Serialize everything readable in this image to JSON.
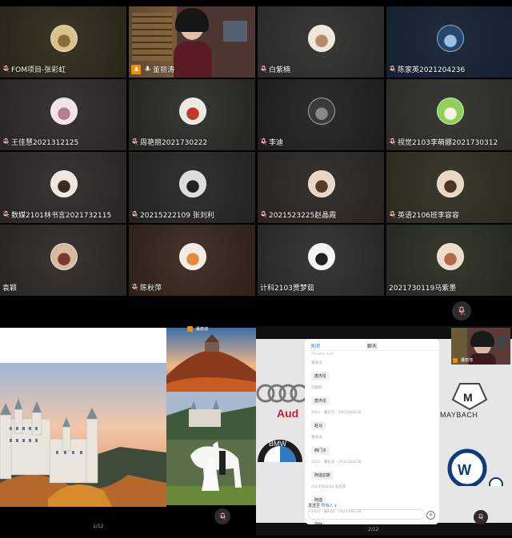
{
  "participants": [
    {
      "name": "FOM项目-张彩虹",
      "bg": [
        "#3d3626",
        "#2a2418"
      ],
      "av": [
        "#d9c28a",
        "#8a6b3a"
      ],
      "mic": true
    },
    {
      "name": "董丽涛",
      "bg": [
        "#3a2f2a",
        "#5a3b36"
      ],
      "av": null,
      "mic": true,
      "speaking": true,
      "video": true
    },
    {
      "name": "白紫楠",
      "bg": [
        "#3b3a37",
        "#28292a"
      ],
      "av": [
        "#f0e6da",
        "#b58b6a"
      ],
      "mic": true
    },
    {
      "name": "陈家英2021204236",
      "bg": [
        "#1f2c3d",
        "#152130"
      ],
      "av": [
        "#25466d",
        "#9ac0e8"
      ],
      "mic": true
    },
    {
      "name": "王佳慧2021312125",
      "bg": [
        "#3c3438",
        "#2a2527"
      ],
      "av": [
        "#f2e5ea",
        "#b87f8c"
      ],
      "mic": true
    },
    {
      "name": "周艳丽2021730222",
      "bg": [
        "#3a3a36",
        "#24251f"
      ],
      "av": [
        "#ece9e0",
        "#c23a2c"
      ],
      "mic": true
    },
    {
      "name": "李迪",
      "bg": [
        "#2e2e2e",
        "#1d1d1d"
      ],
      "av": [
        "#3a3a3a",
        "#888888"
      ],
      "mic": true
    },
    {
      "name": "视觉2103李萌娜2021730312",
      "bg": [
        "#3b3b35",
        "#2b2c26"
      ],
      "av": [
        "#8fd15a",
        "#f4f1e2"
      ],
      "mic": true
    },
    {
      "name": "数媒2101林书言2021732115",
      "bg": [
        "#3a3633",
        "#282523"
      ],
      "av": [
        "#efe6de",
        "#3c2c24"
      ],
      "mic": true
    },
    {
      "name": "20215222109 张刘利",
      "bg": [
        "#333333",
        "#222222"
      ],
      "av": [
        "#dcdcdc",
        "#222222"
      ],
      "mic": true
    },
    {
      "name": "2021523225赵晶霞",
      "bg": [
        "#393430",
        "#27231f"
      ],
      "av": [
        "#e8d6c8",
        "#5b3a2a"
      ],
      "mic": true
    },
    {
      "name": "英语2106班李容容",
      "bg": [
        "#3d3a2e",
        "#2b2a20"
      ],
      "av": [
        "#e8d8c2",
        "#4a3422"
      ],
      "mic": true
    },
    {
      "name": "袁颖",
      "bg": [
        "#3a3632",
        "#282420"
      ],
      "av": [
        "#d7b8a0",
        "#7b3b2a"
      ],
      "mic": false
    },
    {
      "name": "陈秋萍",
      "bg": [
        "#473428",
        "#2c2018"
      ],
      "av": [
        "#f3ece4",
        "#e58a3c"
      ],
      "mic": true
    },
    {
      "name": "计科2103贾梦茹",
      "bg": [
        "#3a3a3a",
        "#262626"
      ],
      "av": [
        "#f5f5f5",
        "#222222"
      ],
      "mic": false
    },
    {
      "name": "2021730119马紫墨",
      "bg": [
        "#373a2e",
        "#25281f"
      ],
      "av": [
        "#ecdcc8",
        "#b06a4a"
      ],
      "mic": false
    }
  ],
  "left_pane": {
    "page_indicator": "1/12",
    "thumb_label": "董丽涛"
  },
  "right_pane": {
    "page_indicator": "2/12",
    "thumb_label": "董丽涛",
    "logos": {
      "audi": "Audi",
      "maybach": "MAYBACH",
      "vw_caption": "Volkswagen"
    }
  },
  "chat": {
    "back_label": "关闭",
    "title": "聊天",
    "top_clip": "Theodric Audi",
    "messages": [
      {
        "meta": "董丽涛",
        "text": "唐杰伦"
      },
      {
        "meta": "白紫楠",
        "text": "唐杰伦"
      },
      {
        "meta": "2021 - 董彩凤 - 2021204236",
        "text": "赵马"
      },
      {
        "meta": "董丽涛",
        "text": "西门子"
      },
      {
        "meta": "2021 - 董彩凤 - 2021204236",
        "text": "阿迪达斯"
      },
      {
        "meta": "2021F62010 赵晶霞",
        "text": "阿迪"
      },
      {
        "meta": "2021 - 董彩凤 - 2021204236",
        "text": "福特"
      },
      {
        "meta": "董丽涛",
        "text": ""
      }
    ],
    "send_to_label": "发送至",
    "send_to_value": "所有人 ▾",
    "plus": "+"
  }
}
